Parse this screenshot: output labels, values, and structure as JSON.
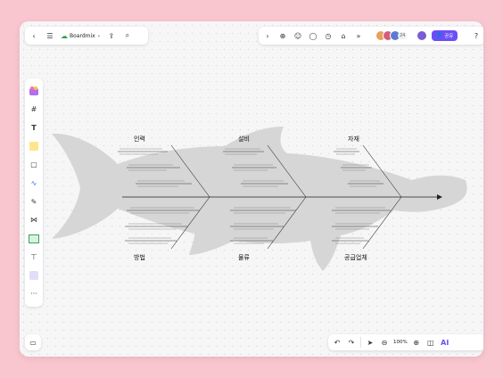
{
  "app": {
    "doc_name": "Boardmix",
    "share_label": "공유",
    "collab_count": "24",
    "zoom": "100%"
  },
  "diagram": {
    "categories": {
      "top": [
        "인력",
        "설비",
        "자재"
      ],
      "bottom": [
        "방법",
        "물류",
        "공급업체"
      ]
    },
    "branch_text_note": "lines of small Korean text along each branch are too small to read"
  },
  "colors": {
    "accent": "#6b4ef7",
    "frame": "#f9c5cf",
    "fish": "#d6d6d6",
    "spine": "#222222"
  },
  "icons": {
    "top_left": [
      "back-icon",
      "menu-icon",
      "cloud-icon",
      "export-icon",
      "search-icon"
    ],
    "top_right": [
      "chevron-right-icon",
      "add-icon",
      "sticker-icon",
      "comment-icon",
      "timer-icon",
      "vote-icon",
      "more-icon",
      "help-icon"
    ],
    "left": [
      "shapes-icon",
      "frame-icon",
      "text-icon",
      "sticky-note-icon",
      "shape-icon",
      "pen-icon",
      "brush-icon",
      "mindmap-icon",
      "table-icon",
      "template-icon",
      "page-icon",
      "more-icon"
    ],
    "bottom_right": [
      "undo-icon",
      "redo-icon",
      "select-icon",
      "zoom-out-icon",
      "zoom-in-icon",
      "book-icon",
      "ai-icon"
    ]
  }
}
